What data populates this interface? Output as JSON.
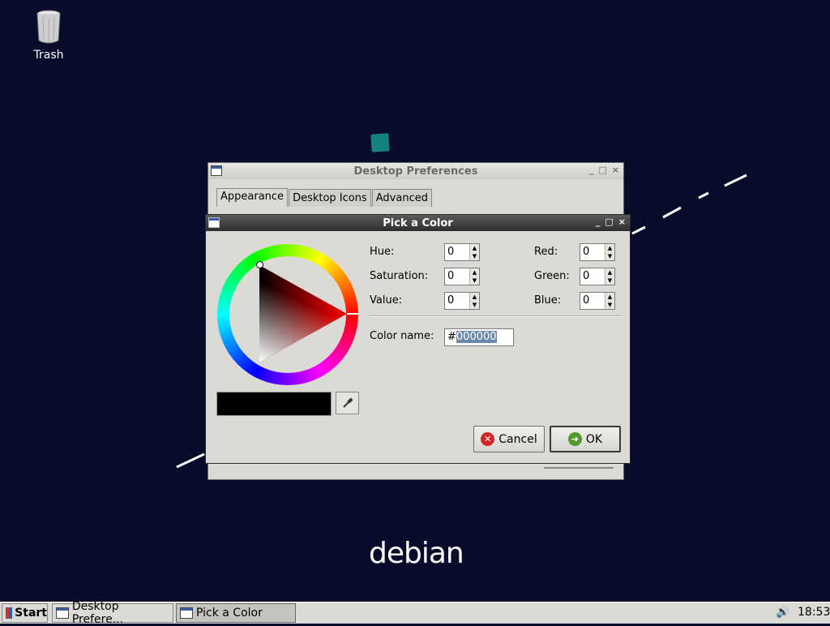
{
  "desktop": {
    "trash_label": "Trash",
    "logo_text": "debian"
  },
  "desktop_prefs": {
    "title": "Desktop Preferences",
    "tabs": [
      {
        "label": "Appearance"
      },
      {
        "label": "Desktop Icons"
      },
      {
        "label": "Advanced"
      }
    ]
  },
  "pick_color": {
    "title": "Pick a Color",
    "fields": {
      "hue": {
        "label": "Hue:",
        "value": "0"
      },
      "saturation": {
        "label": "Saturation:",
        "value": "0"
      },
      "value": {
        "label": "Value:",
        "value": "0"
      },
      "red": {
        "label": "Red:",
        "value": "0"
      },
      "green": {
        "label": "Green:",
        "value": "0"
      },
      "blue": {
        "label": "Blue:",
        "value": "0"
      }
    },
    "color_name_label": "Color name:",
    "color_name_prefix": "#",
    "color_name_selected": "000000",
    "cancel_label": "Cancel",
    "ok_label": "OK",
    "current_color": "#000000"
  },
  "taskbar": {
    "start_label": "Start",
    "items": [
      {
        "label": "Desktop Prefere..."
      },
      {
        "label": "Pick a Color"
      }
    ],
    "clock": "18:53"
  },
  "colors": {
    "desktop_bg": "#090b2a",
    "window_bg": "#dcdad5",
    "active_title": "#2e2e2e",
    "selection": "#6f8aa8"
  }
}
